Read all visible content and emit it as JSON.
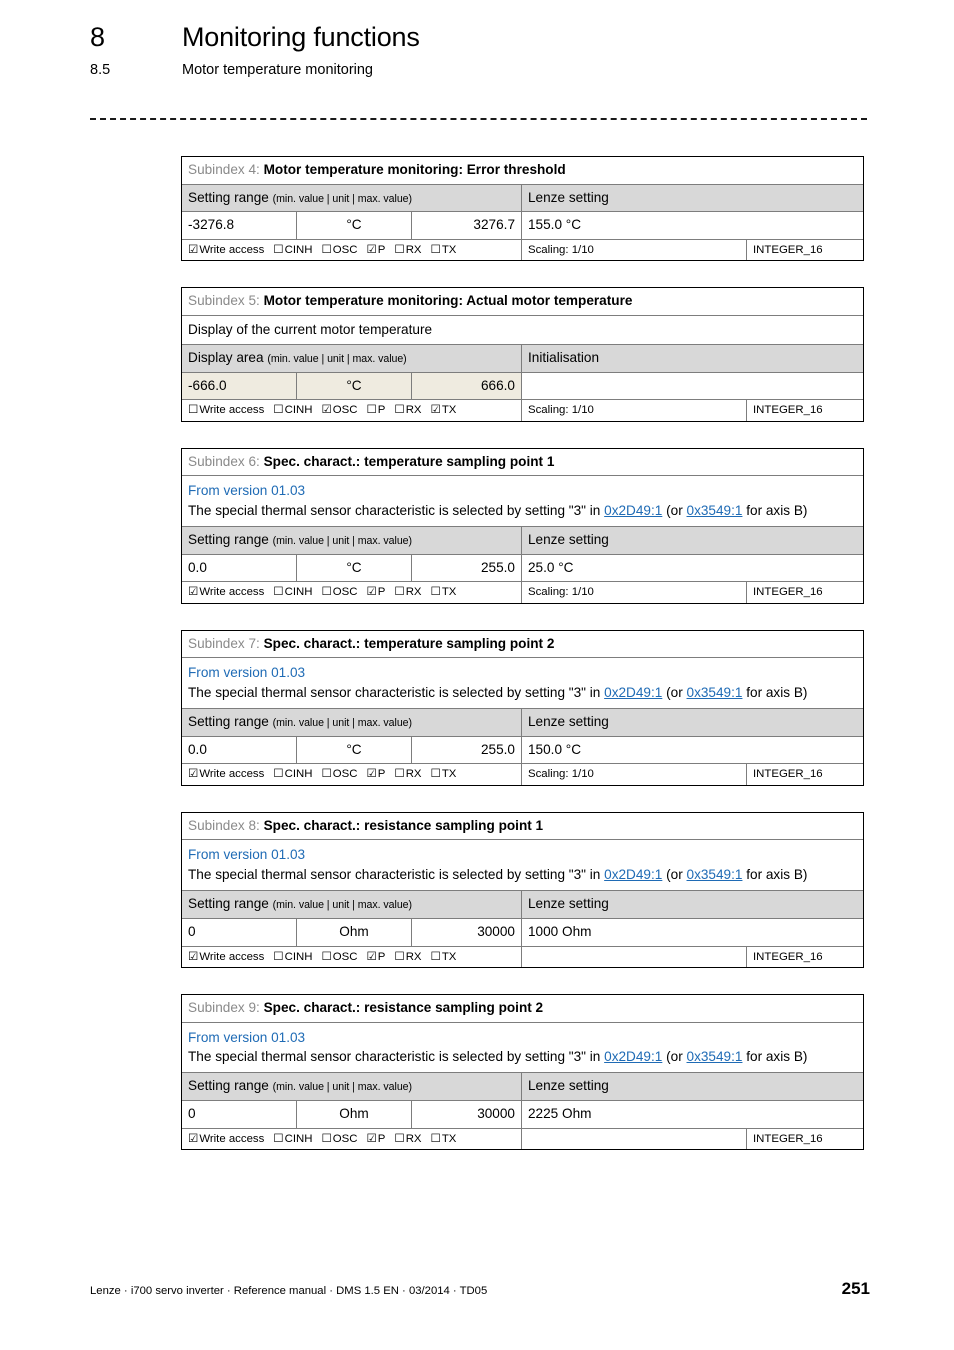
{
  "header": {
    "chapter_number": "8",
    "chapter_title": "Monitoring functions",
    "section_number": "8.5",
    "section_title": "Motor temperature monitoring"
  },
  "labels": {
    "subindex_prefix_4": "Subindex 4:",
    "subindex_prefix_5": "Subindex 5:",
    "subindex_prefix_6": "Subindex 6:",
    "subindex_prefix_7": "Subindex 7:",
    "subindex_prefix_8": "Subindex 8:",
    "subindex_prefix_9": "Subindex 9:",
    "setting_range": "Setting range",
    "setting_range_hint": "(min. value | unit | max. value)",
    "display_area": "Display area",
    "display_area_hint": "(min. value | unit | max. value)",
    "lenze_setting": "Lenze setting",
    "initialisation": "Initialisation",
    "write_access": "Write access",
    "cinh": "CINH",
    "osc": "OSC",
    "p": "P",
    "rx": "RX",
    "tx": "TX",
    "checked_box": "☑",
    "unchecked_box": "☐",
    "from_version": "From version 01.03",
    "note_part1": "The special thermal sensor characteristic is selected by setting \"3\" in ",
    "note_link1": "0x2D49:1",
    "note_part2": " (or ",
    "note_link2": "0x3549:1",
    "note_part3": " for axis B)"
  },
  "blocks": [
    {
      "subindex": "Subindex 4:",
      "title": "Motor temperature monitoring: Error threshold",
      "min": "-3276.8",
      "unit": "°C",
      "max": "3276.7",
      "setting": "155.0 °C",
      "range_header": "Setting range",
      "range_hint": "(min. value | unit | max. value)",
      "setting_header": "Lenze setting",
      "scaling": "Scaling: 1/10",
      "datatype": "INTEGER_16",
      "access": {
        "write": "☑",
        "cinh": "☐",
        "osc": "☐",
        "p": "☑",
        "rx": "☐",
        "tx": "☐"
      }
    },
    {
      "subindex": "Subindex 5:",
      "title": "Motor temperature monitoring: Actual motor temperature",
      "description": "Display of the current motor temperature",
      "min": "-666.0",
      "unit": "°C",
      "max": "666.0",
      "setting": "",
      "range_header": "Display area",
      "range_hint": "(min. value | unit | max. value)",
      "setting_header": "Initialisation",
      "scaling": "Scaling: 1/10",
      "datatype": "INTEGER_16",
      "access": {
        "write": "☐",
        "cinh": "☐",
        "osc": "☑",
        "p": "☐",
        "rx": "☐",
        "tx": "☑"
      }
    },
    {
      "subindex": "Subindex 6:",
      "title": "Spec. charact.: temperature sampling point 1",
      "has_note": true,
      "min": "0.0",
      "unit": "°C",
      "max": "255.0",
      "setting": "25.0 °C",
      "range_header": "Setting range",
      "range_hint": "(min. value | unit | max. value)",
      "setting_header": "Lenze setting",
      "scaling": "Scaling: 1/10",
      "datatype": "INTEGER_16",
      "access": {
        "write": "☑",
        "cinh": "☐",
        "osc": "☐",
        "p": "☑",
        "rx": "☐",
        "tx": "☐"
      }
    },
    {
      "subindex": "Subindex 7:",
      "title": "Spec. charact.: temperature sampling point 2",
      "has_note": true,
      "min": "0.0",
      "unit": "°C",
      "max": "255.0",
      "setting": "150.0 °C",
      "range_header": "Setting range",
      "range_hint": "(min. value | unit | max. value)",
      "setting_header": "Lenze setting",
      "scaling": "Scaling: 1/10",
      "datatype": "INTEGER_16",
      "access": {
        "write": "☑",
        "cinh": "☐",
        "osc": "☐",
        "p": "☑",
        "rx": "☐",
        "tx": "☐"
      }
    },
    {
      "subindex": "Subindex 8:",
      "title": "Spec. charact.: resistance sampling point 1",
      "has_note": true,
      "min": "0",
      "unit": "Ohm",
      "max": "30000",
      "setting": "1000 Ohm",
      "range_header": "Setting range",
      "range_hint": "(min. value | unit | max. value)",
      "setting_header": "Lenze setting",
      "scaling": "",
      "datatype": "INTEGER_16",
      "access": {
        "write": "☑",
        "cinh": "☐",
        "osc": "☐",
        "p": "☑",
        "rx": "☐",
        "tx": "☐"
      }
    },
    {
      "subindex": "Subindex 9:",
      "title": "Spec. charact.: resistance sampling point 2",
      "has_note": true,
      "min": "0",
      "unit": "Ohm",
      "max": "30000",
      "setting": "2225 Ohm",
      "range_header": "Setting range",
      "range_hint": "(min. value | unit | max. value)",
      "setting_header": "Lenze setting",
      "scaling": "",
      "datatype": "INTEGER_16",
      "access": {
        "write": "☑",
        "cinh": "☐",
        "osc": "☐",
        "p": "☑",
        "rx": "☐",
        "tx": "☐"
      }
    }
  ],
  "footer": {
    "text": "Lenze · i700 servo inverter · Reference manual · DMS 1.5 EN · 03/2014 · TD05",
    "page": "251"
  }
}
